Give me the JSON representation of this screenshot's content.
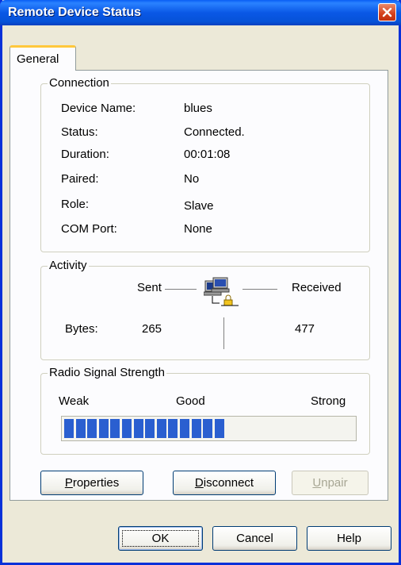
{
  "window": {
    "title": "Remote Device Status"
  },
  "tabs": [
    {
      "label": "General"
    }
  ],
  "connection": {
    "legend": "Connection",
    "rows": [
      {
        "label": "Device Name:",
        "value": "blues"
      },
      {
        "label": "Status:",
        "value": "Connected."
      },
      {
        "label": "Duration:",
        "value": "00:01:08"
      },
      {
        "label": "Paired:",
        "value": "No"
      },
      {
        "label": "Role:",
        "value": "Slave"
      },
      {
        "label": "COM Port:",
        "value": "None"
      }
    ]
  },
  "activity": {
    "legend": "Activity",
    "sent_label": "Sent",
    "received_label": "Received",
    "bytes_label": "Bytes:",
    "bytes_sent": "265",
    "bytes_received": "477",
    "icon": "network-computers-icon"
  },
  "signal": {
    "legend": "Radio Signal Strength",
    "weak_label": "Weak",
    "good_label": "Good",
    "strong_label": "Strong",
    "level_segments": 14,
    "bar_color": "#2a5fd0"
  },
  "actions": {
    "properties": {
      "pre": "",
      "key": "P",
      "post": "roperties"
    },
    "disconnect": {
      "pre": "",
      "key": "D",
      "post": "isconnect"
    },
    "unpair": {
      "pre": "",
      "key": "U",
      "post": "npair"
    }
  },
  "footer": {
    "ok": "OK",
    "cancel": "Cancel",
    "help": "Help"
  },
  "colors": {
    "titlebar": "#0a58e6",
    "dialog_bg": "#ece9d8",
    "panel_bg": "#fcfcfe"
  }
}
